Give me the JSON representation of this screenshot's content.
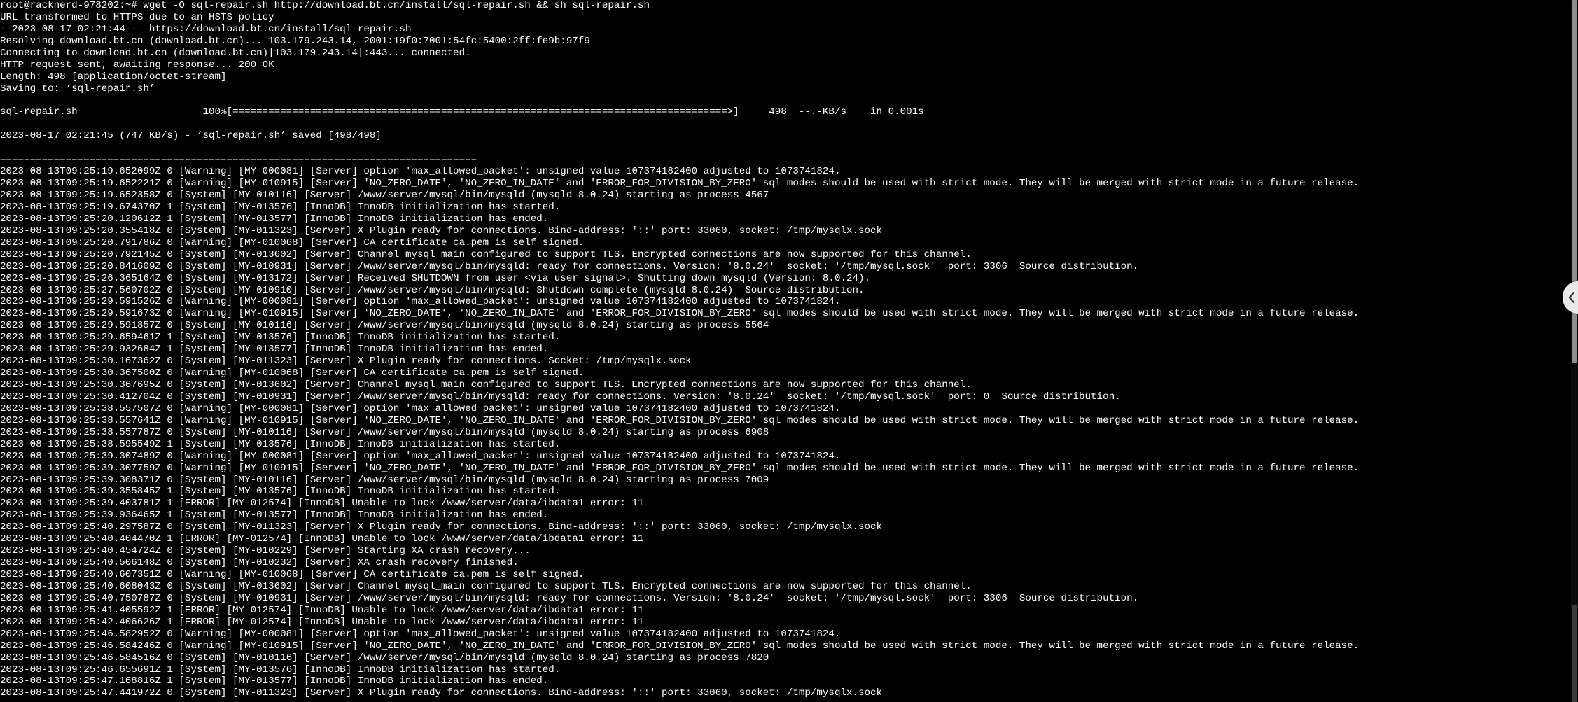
{
  "terminal": {
    "lines": [
      "root@racknerd-978202:~# wget -O sql-repair.sh http://download.bt.cn/install/sql-repair.sh && sh sql-repair.sh",
      "URL transformed to HTTPS due to an HSTS policy",
      "--2023-08-17 02:21:44--  https://download.bt.cn/install/sql-repair.sh",
      "Resolving download.bt.cn (download.bt.cn)... 103.179.243.14, 2001:19f0:7001:54fc:5400:2ff:fe9b:97f9",
      "Connecting to download.bt.cn (download.bt.cn)|103.179.243.14|:443... connected.",
      "HTTP request sent, awaiting response... 200 OK",
      "Length: 498 [application/octet-stream]",
      "Saving to: ‘sql-repair.sh’",
      "",
      "sql-repair.sh                     100%[===================================================================================>]     498  --.-KB/s    in 0.001s",
      "",
      "2023-08-17 02:21:45 (747 KB/s) - ‘sql-repair.sh’ saved [498/498]",
      "",
      "================================================================================",
      "2023-08-13T09:25:19.652099Z 0 [Warning] [MY-000081] [Server] option 'max_allowed_packet': unsigned value 107374182400 adjusted to 1073741824.",
      "2023-08-13T09:25:19.652221Z 0 [Warning] [MY-010915] [Server] 'NO_ZERO_DATE', 'NO_ZERO_IN_DATE' and 'ERROR_FOR_DIVISION_BY_ZERO' sql modes should be used with strict mode. They will be merged with strict mode in a future release.",
      "2023-08-13T09:25:19.652358Z 0 [System] [MY-010116] [Server] /www/server/mysql/bin/mysqld (mysqld 8.0.24) starting as process 4567",
      "2023-08-13T09:25:19.674370Z 1 [System] [MY-013576] [InnoDB] InnoDB initialization has started.",
      "2023-08-13T09:25:20.120612Z 1 [System] [MY-013577] [InnoDB] InnoDB initialization has ended.",
      "2023-08-13T09:25:20.355418Z 0 [System] [MY-011323] [Server] X Plugin ready for connections. Bind-address: '::' port: 33060, socket: /tmp/mysqlx.sock",
      "2023-08-13T09:25:20.791786Z 0 [Warning] [MY-010068] [Server] CA certificate ca.pem is self signed.",
      "2023-08-13T09:25:20.792145Z 0 [System] [MY-013602] [Server] Channel mysql_main configured to support TLS. Encrypted connections are now supported for this channel.",
      "2023-08-13T09:25:20.841609Z 0 [System] [MY-010931] [Server] /www/server/mysql/bin/mysqld: ready for connections. Version: '8.0.24'  socket: '/tmp/mysql.sock'  port: 3306  Source distribution.",
      "2023-08-13T09:25:26.365164Z 0 [System] [MY-013172] [Server] Received SHUTDOWN from user <via user signal>. Shutting down mysqld (Version: 8.0.24).",
      "2023-08-13T09:25:27.560702Z 0 [System] [MY-010910] [Server] /www/server/mysql/bin/mysqld: Shutdown complete (mysqld 8.0.24)  Source distribution.",
      "2023-08-13T09:25:29.591526Z 0 [Warning] [MY-000081] [Server] option 'max_allowed_packet': unsigned value 107374182400 adjusted to 1073741824.",
      "2023-08-13T09:25:29.591673Z 0 [Warning] [MY-010915] [Server] 'NO_ZERO_DATE', 'NO_ZERO_IN_DATE' and 'ERROR_FOR_DIVISION_BY_ZERO' sql modes should be used with strict mode. They will be merged with strict mode in a future release.",
      "2023-08-13T09:25:29.591857Z 0 [System] [MY-010116] [Server] /www/server/mysql/bin/mysqld (mysqld 8.0.24) starting as process 5564",
      "2023-08-13T09:25:29.659461Z 1 [System] [MY-013576] [InnoDB] InnoDB initialization has started.",
      "2023-08-13T09:25:29.932684Z 1 [System] [MY-013577] [InnoDB] InnoDB initialization has ended.",
      "2023-08-13T09:25:30.167362Z 0 [System] [MY-011323] [Server] X Plugin ready for connections. Socket: /tmp/mysqlx.sock",
      "2023-08-13T09:25:30.367500Z 0 [Warning] [MY-010068] [Server] CA certificate ca.pem is self signed.",
      "2023-08-13T09:25:30.367695Z 0 [System] [MY-013602] [Server] Channel mysql_main configured to support TLS. Encrypted connections are now supported for this channel.",
      "2023-08-13T09:25:30.412704Z 0 [System] [MY-010931] [Server] /www/server/mysql/bin/mysqld: ready for connections. Version: '8.0.24'  socket: '/tmp/mysql.sock'  port: 0  Source distribution.",
      "2023-08-13T09:25:38.557507Z 0 [Warning] [MY-000081] [Server] option 'max_allowed_packet': unsigned value 107374182400 adjusted to 1073741824.",
      "2023-08-13T09:25:38.557641Z 0 [Warning] [MY-010915] [Server] 'NO_ZERO_DATE', 'NO_ZERO_IN_DATE' and 'ERROR_FOR_DIVISION_BY_ZERO' sql modes should be used with strict mode. They will be merged with strict mode in a future release.",
      "2023-08-13T09:25:38.557787Z 0 [System] [MY-010116] [Server] /www/server/mysql/bin/mysqld (mysqld 8.0.24) starting as process 6908",
      "2023-08-13T09:25:38.595549Z 1 [System] [MY-013576] [InnoDB] InnoDB initialization has started.",
      "2023-08-13T09:25:39.307489Z 0 [Warning] [MY-000081] [Server] option 'max_allowed_packet': unsigned value 107374182400 adjusted to 1073741824.",
      "2023-08-13T09:25:39.307759Z 0 [Warning] [MY-010915] [Server] 'NO_ZERO_DATE', 'NO_ZERO_IN_DATE' and 'ERROR_FOR_DIVISION_BY_ZERO' sql modes should be used with strict mode. They will be merged with strict mode in a future release.",
      "2023-08-13T09:25:39.308371Z 0 [System] [MY-010116] [Server] /www/server/mysql/bin/mysqld (mysqld 8.0.24) starting as process 7009",
      "2023-08-13T09:25:39.355845Z 1 [System] [MY-013576] [InnoDB] InnoDB initialization has started.",
      "2023-08-13T09:25:39.403781Z 1 [ERROR] [MY-012574] [InnoDB] Unable to lock /www/server/data/ibdata1 error: 11",
      "2023-08-13T09:25:39.936465Z 1 [System] [MY-013577] [InnoDB] InnoDB initialization has ended.",
      "2023-08-13T09:25:40.297587Z 0 [System] [MY-011323] [Server] X Plugin ready for connections. Bind-address: '::' port: 33060, socket: /tmp/mysqlx.sock",
      "2023-08-13T09:25:40.404470Z 1 [ERROR] [MY-012574] [InnoDB] Unable to lock /www/server/data/ibdata1 error: 11",
      "2023-08-13T09:25:40.454724Z 0 [System] [MY-010229] [Server] Starting XA crash recovery...",
      "2023-08-13T09:25:40.506148Z 0 [System] [MY-010232] [Server] XA crash recovery finished.",
      "2023-08-13T09:25:40.607351Z 0 [Warning] [MY-010068] [Server] CA certificate ca.pem is self signed.",
      "2023-08-13T09:25:40.608043Z 0 [System] [MY-013602] [Server] Channel mysql_main configured to support TLS. Encrypted connections are now supported for this channel.",
      "2023-08-13T09:25:40.750787Z 0 [System] [MY-010931] [Server] /www/server/mysql/bin/mysqld: ready for connections. Version: '8.0.24'  socket: '/tmp/mysql.sock'  port: 3306  Source distribution.",
      "2023-08-13T09:25:41.405592Z 1 [ERROR] [MY-012574] [InnoDB] Unable to lock /www/server/data/ibdata1 error: 11",
      "2023-08-13T09:25:42.406626Z 1 [ERROR] [MY-012574] [InnoDB] Unable to lock /www/server/data/ibdata1 error: 11",
      "2023-08-13T09:25:46.582952Z 0 [Warning] [MY-000081] [Server] option 'max_allowed_packet': unsigned value 107374182400 adjusted to 1073741824.",
      "2023-08-13T09:25:46.584246Z 0 [Warning] [MY-010915] [Server] 'NO_ZERO_DATE', 'NO_ZERO_IN_DATE' and 'ERROR_FOR_DIVISION_BY_ZERO' sql modes should be used with strict mode. They will be merged with strict mode in a future release.",
      "2023-08-13T09:25:46.584516Z 0 [System] [MY-010116] [Server] /www/server/mysql/bin/mysqld (mysqld 8.0.24) starting as process 7820",
      "2023-08-13T09:25:46.655691Z 1 [System] [MY-013576] [InnoDB] InnoDB initialization has started.",
      "2023-08-13T09:25:47.168816Z 1 [System] [MY-013577] [InnoDB] InnoDB initialization has ended.",
      "2023-08-13T09:25:47.441972Z 0 [System] [MY-011323] [Server] X Plugin ready for connections. Bind-address: '::' port: 33060, socket: /tmp/mysqlx.sock"
    ]
  },
  "side_panel": {
    "icon": "chevron-left-icon"
  },
  "colors": {
    "background": "#000000",
    "text": "#ffffff",
    "scrollbar_thumb": "#8d8d8d",
    "side_tab": "#e9e9e9"
  }
}
